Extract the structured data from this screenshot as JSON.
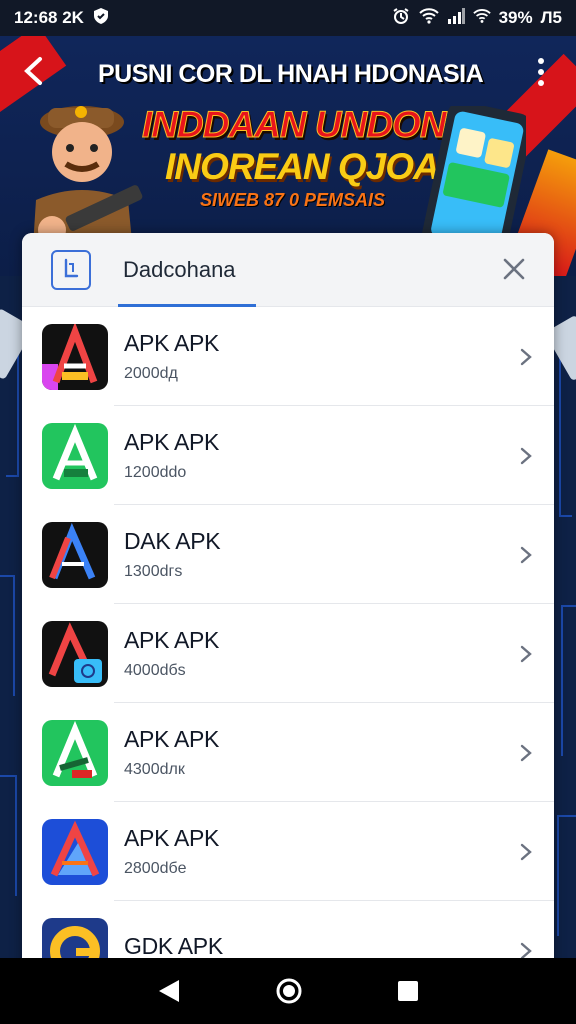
{
  "status_bar": {
    "time": "12:68 2K",
    "battery": "39%",
    "carrier": "Л5"
  },
  "banner": {
    "title": "PUSNI COR DL HNAH HDONASIA",
    "headline_1": "INDDAAN UNDONIAN",
    "headline_2": "INOREAN QJOAAI!",
    "subheadline": "SIWEB  87 0  PEMSAIS"
  },
  "sheet": {
    "title": "Dadcohana",
    "accent_color": "#2f6fd6"
  },
  "apps": [
    {
      "name": "APK APK",
      "size": "2000dд",
      "icon": "a-logo-black-red-icon"
    },
    {
      "name": "APK APK",
      "size": "1200ddo",
      "icon": "a-logo-green-icon"
    },
    {
      "name": "DAK APK",
      "size": "1300dгs",
      "icon": "a-logo-black-blue-icon"
    },
    {
      "name": "APK APK",
      "size": "4000dбs",
      "icon": "a-logo-black-photo-icon"
    },
    {
      "name": "APK APK",
      "size": "4300dлк",
      "icon": "a-logo-green-dark-icon"
    },
    {
      "name": "APK APK",
      "size": "2800dбe",
      "icon": "a-logo-blue-red-icon"
    },
    {
      "name": "GDK APK",
      "size": "",
      "icon": "g-logo-yellow-icon"
    }
  ]
}
